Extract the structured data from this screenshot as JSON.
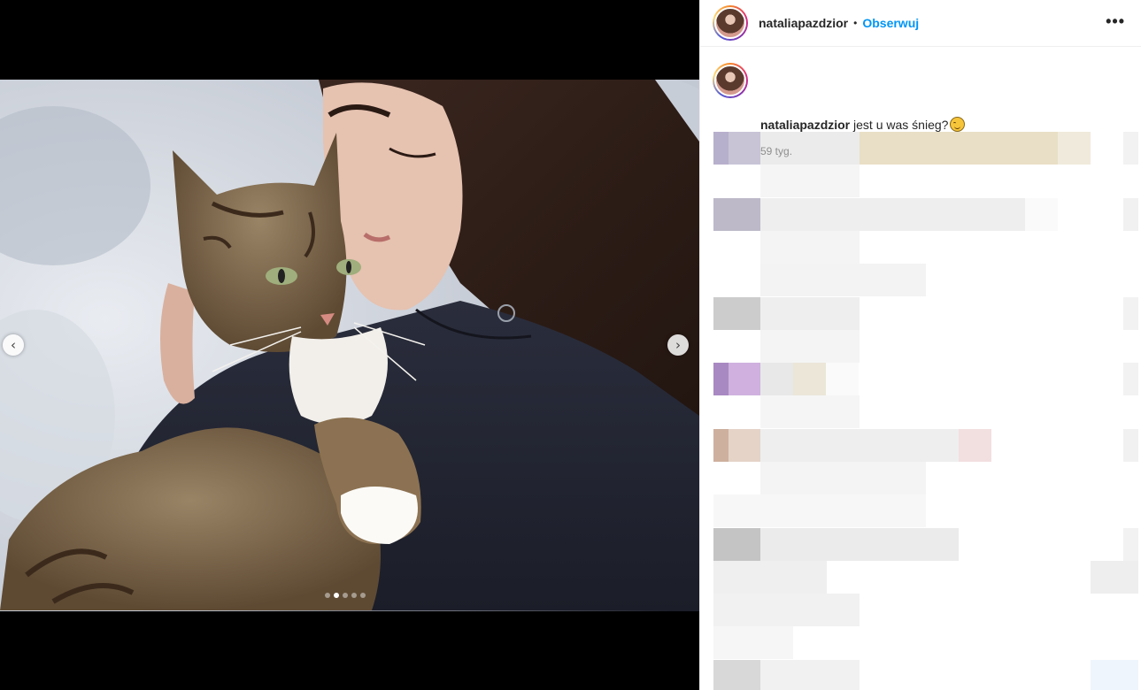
{
  "post": {
    "username": "nataliapazdzior",
    "separator": "•",
    "follow_label": "Obserwuj",
    "more_icon": "more-options-icon",
    "more_glyph": "•••",
    "caption_username": "nataliapazdzior",
    "caption_text": "jest u was śnieg?",
    "caption_emoji": "smiling-face-emoji",
    "timestamp": "59 tyg."
  },
  "carousel": {
    "slide_count": 5,
    "active_index": 1,
    "prev_icon": "chevron-left-icon",
    "next_icon": "chevron-right-icon",
    "prev_glyph": "‹",
    "next_glyph": "›"
  },
  "colors": {
    "accent": "#0095f6",
    "muted": "#8e8e8e",
    "text": "#262626",
    "divider": "#efefef"
  }
}
